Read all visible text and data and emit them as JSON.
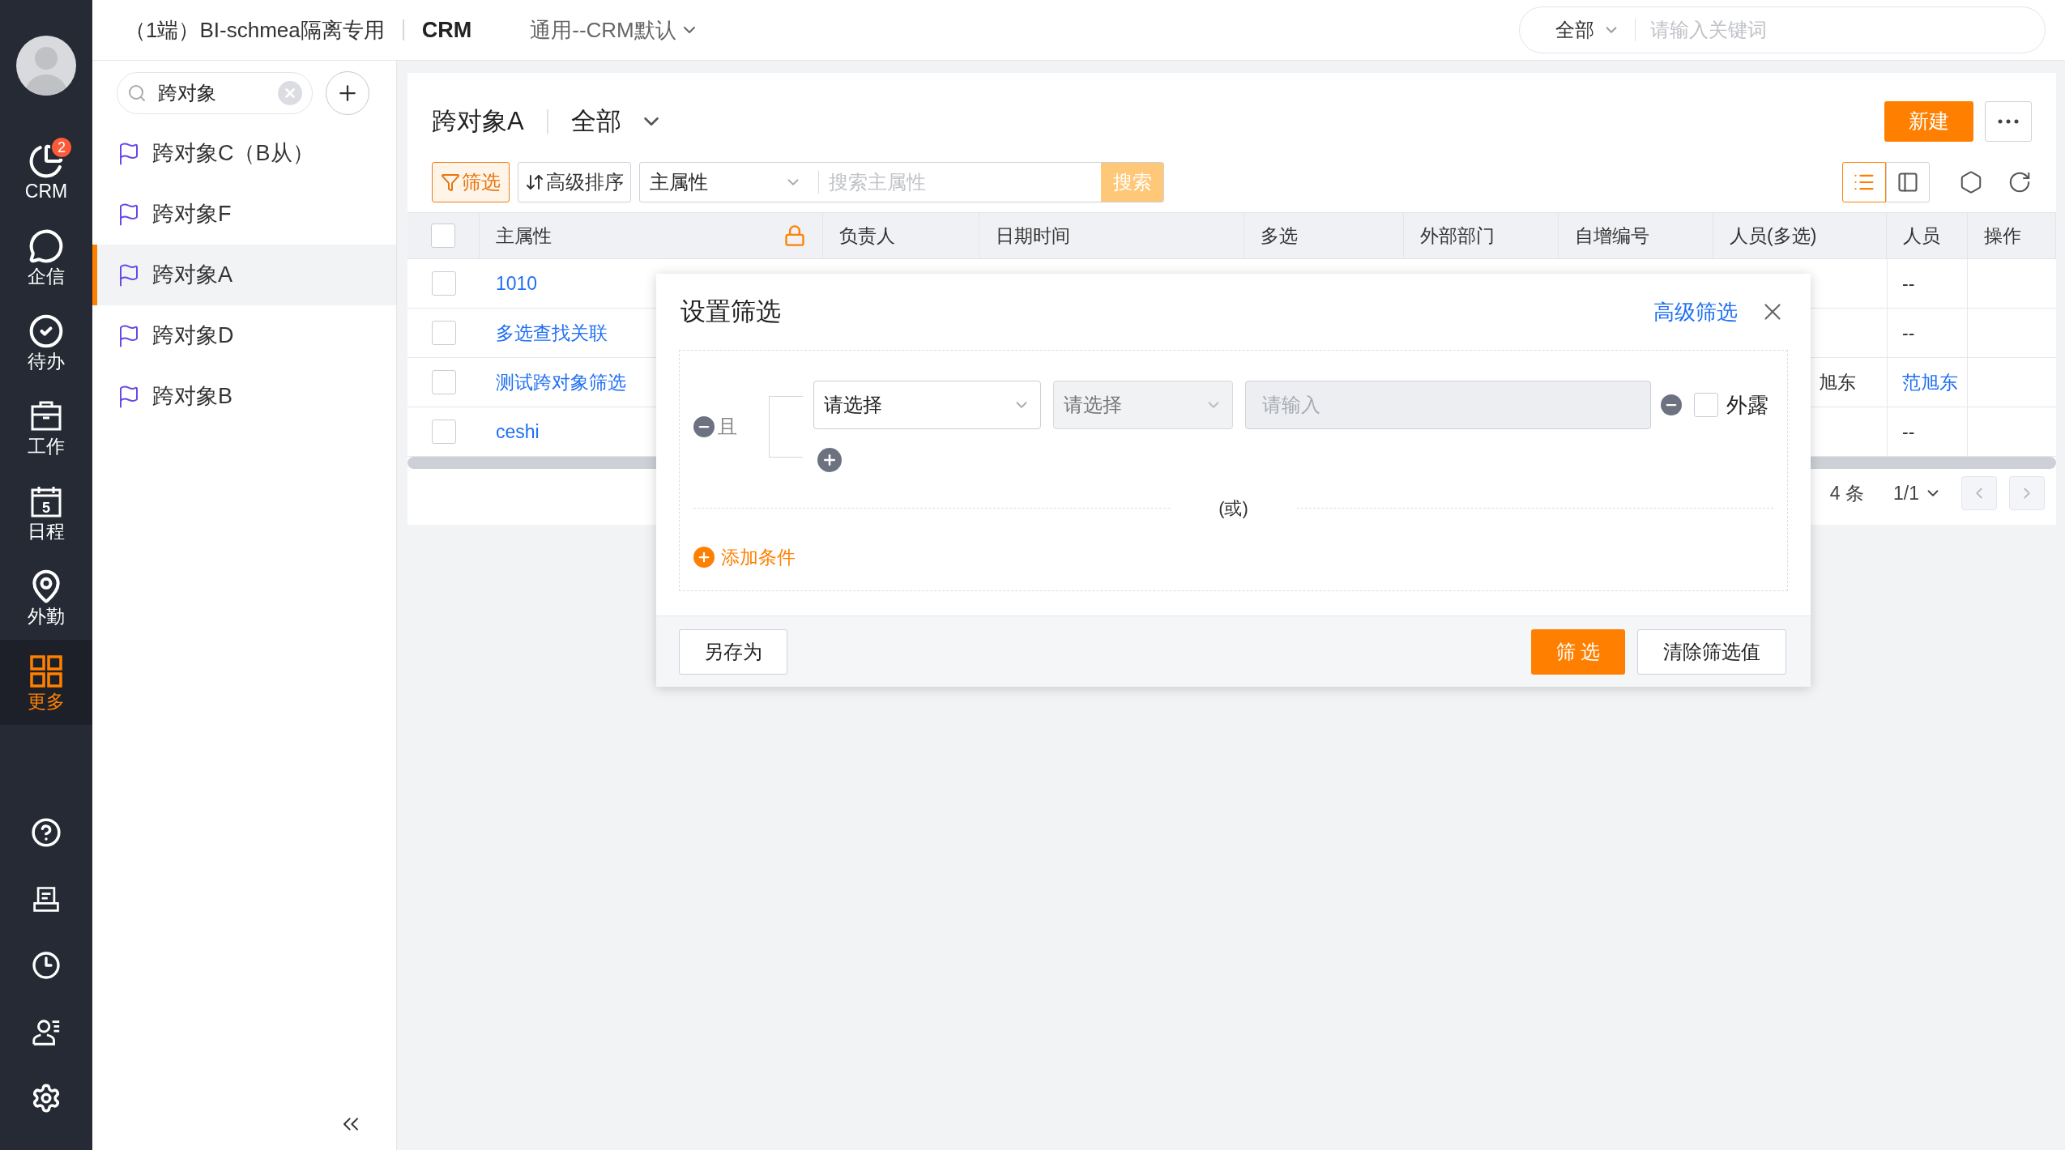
{
  "top_bar": {
    "tenant": "（1端）BI-schmea隔离专用",
    "app": "CRM",
    "view": "通用--CRM默认",
    "search_scope": "全部",
    "search_placeholder": "请输入关键词"
  },
  "nav": {
    "items": [
      {
        "label": "CRM",
        "badge": "2",
        "selected": false
      },
      {
        "label": "企信",
        "selected": false
      },
      {
        "label": "待办",
        "selected": false
      },
      {
        "label": "工作",
        "selected": false
      },
      {
        "label": "日程",
        "day": "5",
        "selected": false
      },
      {
        "label": "外勤",
        "selected": false
      },
      {
        "label": "更多",
        "selected": true
      }
    ]
  },
  "object_list": {
    "search_value": "跨对象",
    "items": [
      {
        "label": "跨对象C（B从）",
        "selected": false
      },
      {
        "label": "跨对象F",
        "selected": false
      },
      {
        "label": "跨对象A",
        "selected": true
      },
      {
        "label": "跨对象D",
        "selected": false
      },
      {
        "label": "跨对象B",
        "selected": false
      }
    ]
  },
  "list_view": {
    "title": "跨对象A",
    "scope": "全部",
    "new_button": "新建",
    "filter_button": "筛选",
    "sort_button": "高级排序",
    "search_field": "主属性",
    "search_placeholder": "搜索主属性",
    "search_button": "搜索",
    "view_toggle": [
      {
        "selected": true
      },
      {
        "selected": false
      }
    ],
    "table": {
      "header_checked": false,
      "columns": [
        "主属性",
        "负责人",
        "日期时间",
        "多选",
        "外部部门",
        "自增编号",
        "人员(多选)",
        "人员",
        "操作"
      ],
      "rows": [
        {
          "checked": false,
          "name": "1010",
          "person": "--",
          "person_link": false
        },
        {
          "checked": false,
          "name": "多选查找关联",
          "person": "--",
          "person_link": false
        },
        {
          "checked": false,
          "name": "测试跨对象筛选",
          "people_multi": "旭东",
          "person": "范旭东",
          "person_link": true
        },
        {
          "checked": false,
          "name": "ceshi",
          "person": "--",
          "person_link": false
        }
      ]
    },
    "pagination": {
      "total": "4 条",
      "page": "1/1"
    }
  },
  "filter_dialog": {
    "title": "设置筛选",
    "advanced_link": "高级筛选",
    "group_label": "且",
    "condition": {
      "field_placeholder": "请选择",
      "operator_placeholder": "请选择",
      "operator_disabled": true,
      "value_placeholder": "请输入",
      "value_disabled": true,
      "exposed_label": "外露",
      "exposed": false
    },
    "or_separator": "(或)",
    "add_condition": "添加条件",
    "save_as": "另存为",
    "apply": "筛 选",
    "clear": "清除筛选值"
  }
}
